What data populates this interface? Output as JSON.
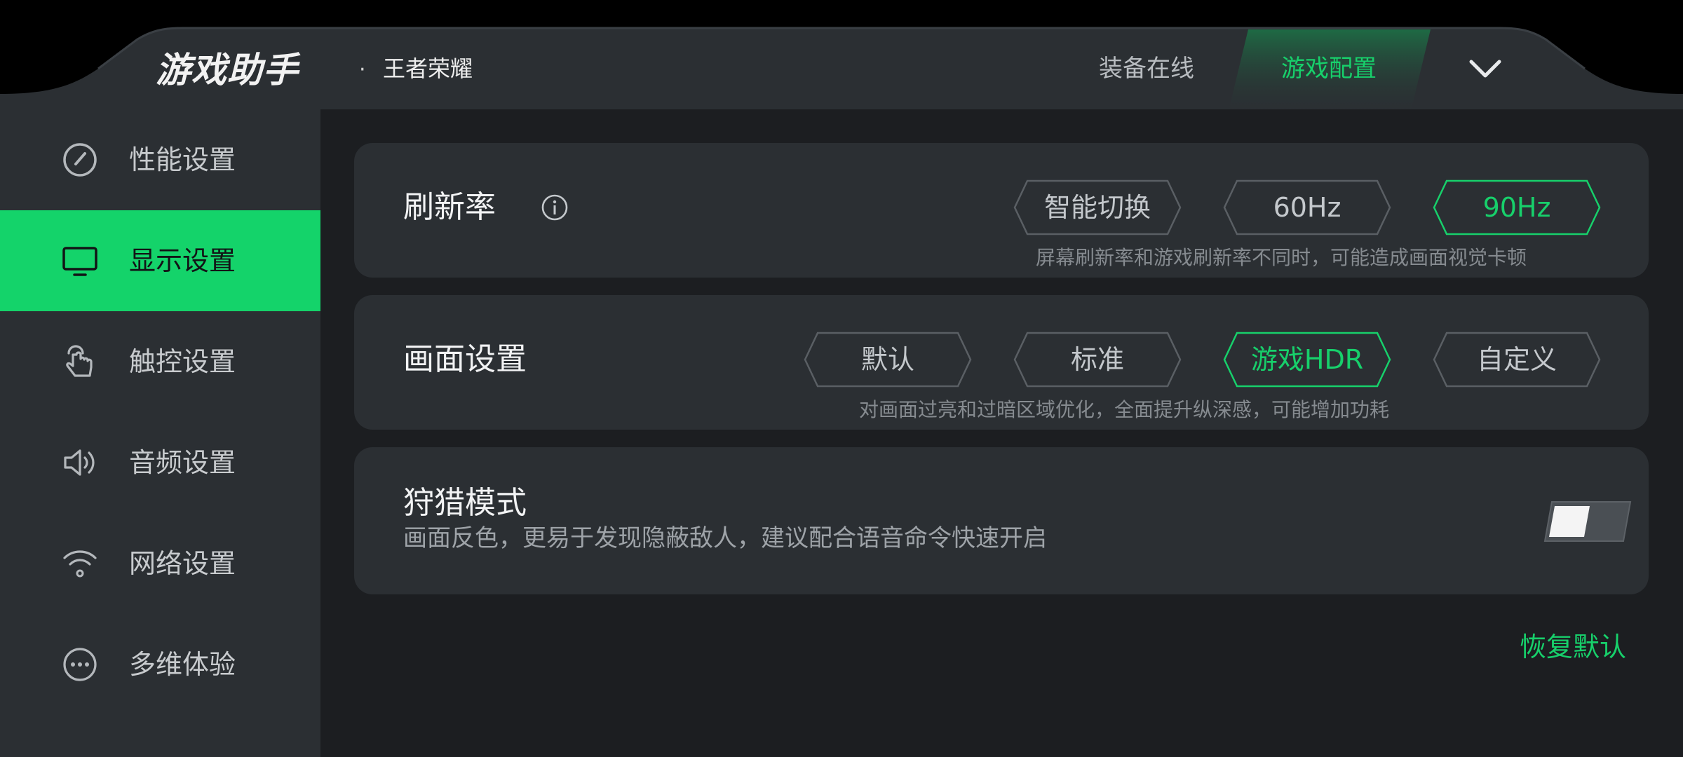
{
  "header": {
    "brand": "游戏助手",
    "separator": "·",
    "game_name": "王者荣耀",
    "tabs": [
      {
        "label": "装备在线",
        "active": false
      },
      {
        "label": "游戏配置",
        "active": true
      }
    ],
    "collapse_icon": "chevron-down-icon"
  },
  "sidebar": {
    "items": [
      {
        "label": "性能设置",
        "icon": "speedometer-icon",
        "active": false
      },
      {
        "label": "显示设置",
        "icon": "monitor-icon",
        "active": true
      },
      {
        "label": "触控设置",
        "icon": "touch-hand-icon",
        "active": false
      },
      {
        "label": "音频设置",
        "icon": "speaker-icon",
        "active": false
      },
      {
        "label": "网络设置",
        "icon": "wifi-icon",
        "active": false
      },
      {
        "label": "多维体验",
        "icon": "more-dots-icon",
        "active": false
      }
    ]
  },
  "refresh": {
    "title": "刷新率",
    "info_icon": "info-icon",
    "options": [
      "智能切换",
      "60Hz",
      "90Hz"
    ],
    "selected": "90Hz",
    "desc": "屏幕刷新率和游戏刷新率不同时，可能造成画面视觉卡顿"
  },
  "picture": {
    "title": "画面设置",
    "options": [
      "默认",
      "标准",
      "游戏HDR",
      "自定义"
    ],
    "selected": "游戏HDR",
    "desc": "对画面过亮和过暗区域优化，全面提升纵深感，可能增加功耗"
  },
  "hunting": {
    "title": "狩猎模式",
    "desc": "画面反色，更易于发现隐蔽敌人，建议配合语音命令快速开启",
    "enabled": false
  },
  "restore_label": "恢复默认",
  "colors": {
    "accent": "#14d36a",
    "panel": "#2b2f33",
    "background": "#1c1e21"
  }
}
